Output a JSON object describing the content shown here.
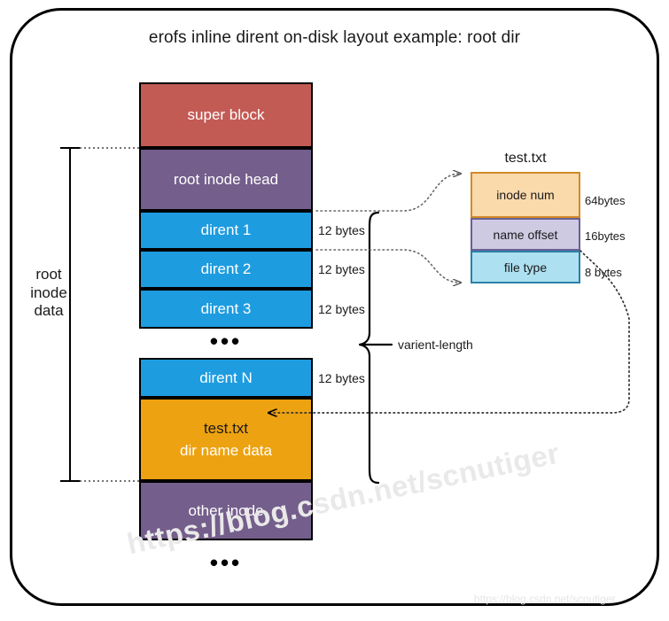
{
  "title": "erofs inline dirent on-disk layout example: root dir",
  "layout_column": {
    "blocks": [
      {
        "label": "super block",
        "color": "#c35b55",
        "size_label": ""
      },
      {
        "label": "root inode head",
        "color": "#745e8b",
        "size_label": ""
      },
      {
        "label": "dirent 1",
        "color": "#1e9ce0",
        "size_label": "12 bytes"
      },
      {
        "label": "dirent 2",
        "color": "#1e9ce0",
        "size_label": "12 bytes"
      },
      {
        "label": "dirent 3",
        "color": "#1e9ce0",
        "size_label": "12 bytes"
      },
      {
        "label": "dirent N",
        "color": "#1e9ce0",
        "size_label": "12 bytes"
      },
      {
        "label": "dir name data",
        "color": "#eda211",
        "size_label": "",
        "top_label": "test.txt"
      },
      {
        "label": "other inode",
        "color": "#745e8b",
        "size_label": ""
      }
    ],
    "ellipsis_upper": "•••",
    "ellipsis_lower": "•••"
  },
  "brackets": {
    "root_inode_data_label": "root\ninode\ndata",
    "root_inode_data_line1": "root",
    "root_inode_data_line2": "inode",
    "root_inode_data_line3": "data",
    "varient_length_label": "varient-length"
  },
  "dirent_detail": {
    "title": "test.txt",
    "fields": [
      {
        "label": "inode num",
        "size_label": "64bytes",
        "fill": "#fad9ab",
        "stroke": "#d18a28"
      },
      {
        "label": "name offset",
        "size_label": "16bytes",
        "fill": "#cdcae2",
        "stroke": "#6a5f93"
      },
      {
        "label": "file type",
        "size_label": "8 bytes",
        "fill": "#ade0f0",
        "stroke": "#2a7fa8"
      }
    ]
  },
  "watermarks": {
    "large": "https://blog.csdn.net/scnutiger",
    "small": "https://blog.csdn.net/scnutiger"
  },
  "colors": {
    "super_block": "#c35b55",
    "inode": "#745e8b",
    "dirent": "#1e9ce0",
    "name_data": "#eda211",
    "inode_num": "#fad9ab",
    "name_offset": "#cdcae2",
    "file_type": "#ade0f0",
    "outline": "#000000",
    "watermark": "#e9e9e9"
  }
}
